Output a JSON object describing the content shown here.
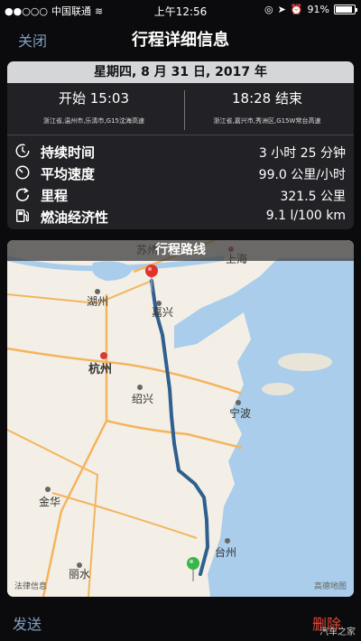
{
  "status": {
    "carrier": "中国联通",
    "time": "上午12:56",
    "battery": "91%",
    "battery_level": 0.91
  },
  "nav": {
    "close": "关闭",
    "title": "行程详细信息"
  },
  "summary": {
    "date": "星期四, 8 月 31 日, 2017 年",
    "start_time": "开始 15:03",
    "end_time": "18:28 结束",
    "start_location": "浙江省,温州市,乐清市,G15沈海高速",
    "end_location": "浙江省,嘉兴市,秀洲区,G15W常台高速"
  },
  "stats": [
    {
      "icon": "duration-icon",
      "label": "持续时间",
      "value": "3 小时 25 分钟"
    },
    {
      "icon": "speed-icon",
      "label": "平均速度",
      "value": "99.0 公里/小时"
    },
    {
      "icon": "mileage-icon",
      "label": "里程",
      "value": "321.5 公里"
    },
    {
      "icon": "fuel-icon",
      "label": "燃油经济性",
      "value": "9.1 l/100 km"
    }
  ],
  "map": {
    "title": "行程路线",
    "legal": "法律信息",
    "brand": "高德地图",
    "cities": [
      "苏州",
      "上海",
      "湖州",
      "嘉兴",
      "杭州",
      "绍兴",
      "宁波",
      "金华",
      "台州",
      "丽水"
    ],
    "colors": {
      "land": "#f3efe6",
      "water": "#a9cdea",
      "route": "#2e5f8f",
      "highway": "#f4b45e"
    }
  },
  "toolbar": {
    "send": "发送",
    "delete": "删除"
  },
  "watermark": "汽车之家"
}
